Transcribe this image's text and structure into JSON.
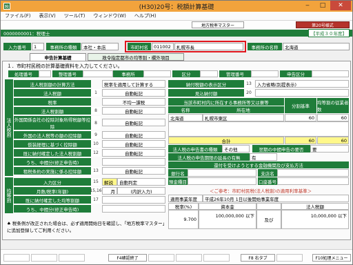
{
  "window": {
    "title": "(H30)20号：税額計算基礎",
    "minimize": "‒",
    "maximize": "□",
    "close": "✕"
  },
  "menu": [
    "ファイル(F)",
    "表示(V)",
    "ツール(T)",
    "ウィンドウ(W)",
    "ヘルプ(H)"
  ],
  "toolbar": {
    "master_btn": "地方税率マスター",
    "form_btn": "第20号様式"
  },
  "header": {
    "company": "0000000001：税理士",
    "era": "【平成３０年度】"
  },
  "info_row": {
    "input_no_label": "入力番号",
    "input_no": "1",
    "office_type_label": "事務所の種類",
    "office_type": "本社・本店",
    "city_label": "市町村名",
    "city_code": "011002",
    "city_name": "札幌市長",
    "office_name_label": "事務所の名称",
    "office_name": "北海道"
  },
  "tabs": [
    "申告計算基礎",
    "政令指定都市の均等割・欄外項目"
  ],
  "panel": {
    "instruction": "１．市町村民税の計算基礎資料を入力してください。",
    "section_row": {
      "kubun": "処理番号",
      "kanri": "整理番号",
      "jimusho": "事務所",
      "kubun2": "区分",
      "kanri2": "管理番号",
      "shinkoku": "申告区分"
    },
    "left_vlabel": "法人税割",
    "left_vlabel2": "均等割",
    "left_rows": [
      {
        "label": "法人税割額の計算方法",
        "num": "",
        "value": "税率を適用して計算する"
      },
      {
        "label": "法人税額",
        "num": "1",
        "value": "自動転記"
      },
      {
        "label": "税率",
        "num": "",
        "value": "不均一課税"
      },
      {
        "label": "法人税割額",
        "num": "8",
        "value": "自動転記"
      },
      {
        "label": "外国関係会社の控除対象所得税額等控除",
        "num": "8",
        "value": "自動転記"
      },
      {
        "label": "外国の法人税等の額の控除額",
        "num": "9",
        "value": "自動転記"
      },
      {
        "label": "仮装経理に基づく控除額",
        "num": "10",
        "value": "自動転記"
      },
      {
        "label": "既に納付確定した法人税割額",
        "num": "12",
        "value": "自動転記"
      },
      {
        "label": "うち、中間分(修正申告時)",
        "num": "",
        "value": ""
      },
      {
        "label": "租税条約の実施に係る控除額",
        "num": "13",
        "value": "自動転記"
      }
    ],
    "kinto_rows": [
      {
        "label": "入力区分",
        "num": "15",
        "value1": "解説",
        "value2": "自動判定"
      },
      {
        "label": "月数/税率(年額)",
        "num": "15,16",
        "value1": "月",
        "value2": "(内訳入力)"
      },
      {
        "label": "既に納付確定した均等割額",
        "num": "17",
        "value1": "",
        "value2": ""
      },
      {
        "label": "うち、中間分(修正申告時)",
        "num": "",
        "value1": "",
        "value2": ""
      }
    ],
    "footnote": "♠ 税条例が改正された場合は、必ず適用開始日を確認し、「地方税率マスター」に追加登録してご利用ください。",
    "right_top": [
      {
        "label": "納付税額の表示区分",
        "num": "13",
        "value": "入力省略(別提表示)"
      },
      {
        "label": "見込納付額",
        "num": "20",
        "value": ""
      }
    ],
    "div_table": {
      "title": "当該市町村内に所在する事務所等又は寮等",
      "head_name": "名称",
      "head_addr": "所在地",
      "head_basis": "分割基準",
      "head_emp": "均等割の従業者数",
      "rows": [
        {
          "name": "北海道",
          "addr": "札幌市東区",
          "basis": "60",
          "emp": "60"
        }
      ],
      "total_label": "合計",
      "total_basis": "60",
      "total_emp": "60"
    },
    "shinkoku_row": {
      "label": "法人税の申告書の種類",
      "value": "その他",
      "label2": "翌期の中間申告の要否",
      "value2": "要"
    },
    "entai_row": {
      "label": "法人税の申告期限の延長の有無",
      "value": "有"
    },
    "bank": {
      "title": "還付を受けようとする金融機関及び支払方法",
      "bank_label": "銀行名",
      "branch_label": "支店名",
      "kind_label": "預金種目",
      "acct_label": "口座番号"
    },
    "rate": {
      "caption": "＜ご参考：市町村民税(法人税割)の適用利率基準＞",
      "period_label": "適用事業年度",
      "period_value": "平成26年10月 1日以後開始事業年度",
      "col_rate": "税率(%)",
      "col_capital": "資本金",
      "col_and": "及び",
      "col_corp": "法人税額",
      "rate_value": "9.700",
      "capital_value": "100,000,000 以下",
      "corp_value": "10,000,000 以下"
    }
  },
  "fkeys": {
    "f4": "F4確認終了",
    "f8": "F8 右タブ",
    "f10": "F10処理メニュー"
  }
}
